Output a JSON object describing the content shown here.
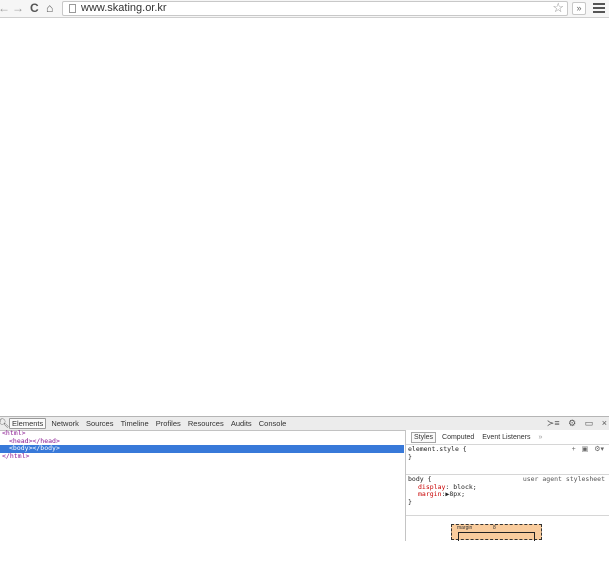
{
  "browser": {
    "url": "www.skating.or.kr",
    "icons": {
      "back": "back-arrow-icon",
      "forward": "forward-arrow-icon",
      "reload": "reload-icon",
      "home": "home-icon",
      "page": "page-icon",
      "star": "star-icon",
      "extensions": "extensions-icon",
      "menu": "hamburger-menu-icon"
    },
    "ext_label": "»"
  },
  "devtools": {
    "tabs": [
      "Elements",
      "Network",
      "Sources",
      "Timeline",
      "Profiles",
      "Resources",
      "Audits",
      "Console"
    ],
    "active_tab": "Elements",
    "dom": {
      "line1": "<html>",
      "line2": "<head></head>",
      "line3": "<body></body>",
      "line4": "</html>"
    },
    "styles": {
      "tabs": [
        "Styles",
        "Computed",
        "Event Listeners",
        "»"
      ],
      "active_tab": "Styles",
      "rule1_selector": "element.style {",
      "rule1_close": "}",
      "rule2_selector": "body {",
      "rule2_source": "user agent stylesheet",
      "rule2_prop1_name": "display",
      "rule2_prop1_value": "block;",
      "rule2_prop2_name": "margin",
      "rule2_prop2_value": "8px;",
      "rule2_close": "}",
      "box_model_label": "margin",
      "box_model_value": "8"
    }
  },
  "colors": {
    "selection": "#3879d9",
    "tag": "#8a1a91",
    "css_property": "#c80000",
    "box_margin": "#f9cc9d"
  }
}
